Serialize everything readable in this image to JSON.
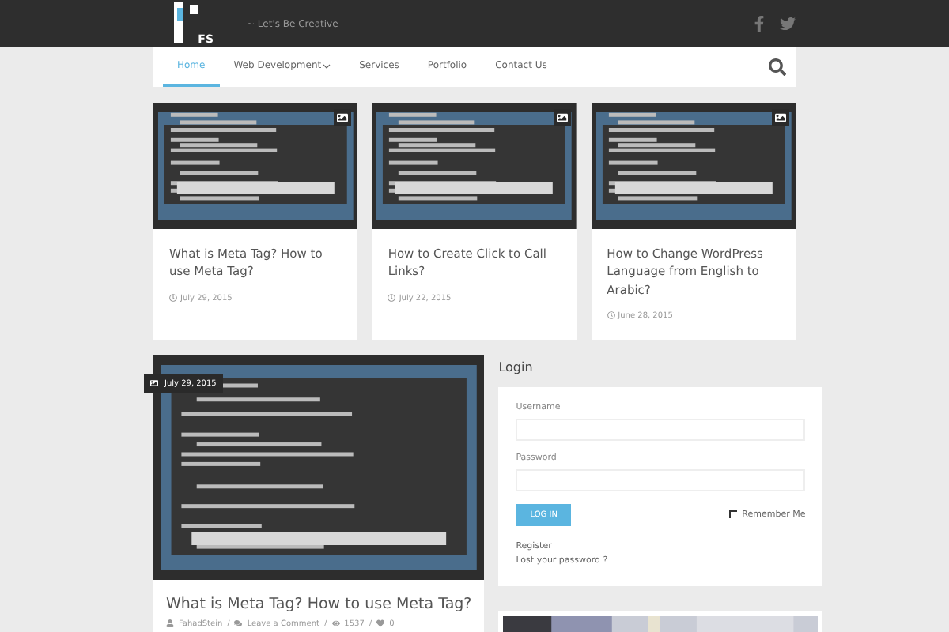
{
  "header": {
    "logo": "FS",
    "tagline": "~ Let's Be Creative"
  },
  "nav": {
    "items": [
      {
        "label": "Home",
        "selected": true,
        "dropdown": false
      },
      {
        "label": "Web Development",
        "selected": false,
        "dropdown": true
      },
      {
        "label": "Services",
        "selected": false,
        "dropdown": false
      },
      {
        "label": "Portfolio",
        "selected": false,
        "dropdown": false
      },
      {
        "label": "Contact Us",
        "selected": false,
        "dropdown": false
      }
    ]
  },
  "posts": [
    {
      "title": "What is Meta Tag? How to use Meta Tag?",
      "date": "July 29, 2015"
    },
    {
      "title": "How to Create Click to Call Links?",
      "date": "July 22, 2015"
    },
    {
      "title": "How to Change WordPress Language from English to Arabic?",
      "date": "June 28, 2015"
    }
  ],
  "featured": {
    "date": "July 29, 2015",
    "title": "What is Meta Tag? How to use Meta Tag?",
    "author": "FahadStein",
    "comments": "Leave a Comment",
    "views": "1537",
    "likes": "0",
    "separator": "/"
  },
  "login": {
    "heading": "Login",
    "username_label": "Username",
    "password_label": "Password",
    "button": "LOG IN",
    "remember": {
      "label": "Remember Me",
      "checked": false
    },
    "links": [
      "Register",
      "Lost your password ?"
    ]
  }
}
